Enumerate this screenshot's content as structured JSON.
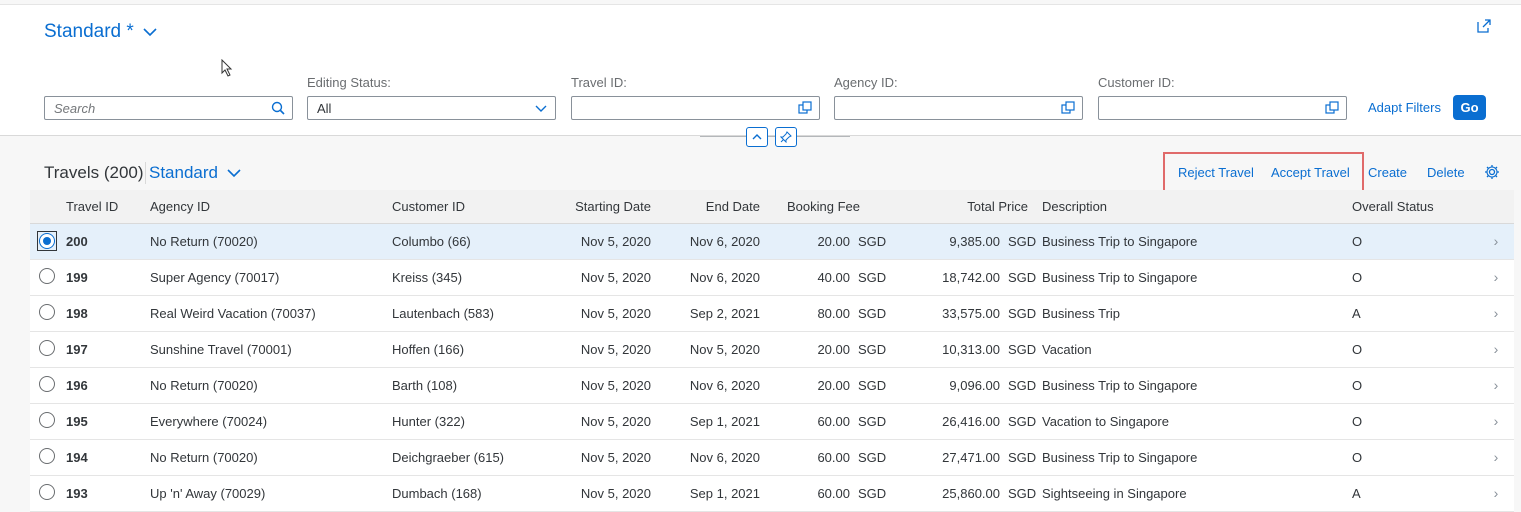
{
  "header": {
    "variant_label": "Standard *",
    "search": {
      "placeholder": "Search"
    },
    "filters": [
      {
        "label": "Editing Status:",
        "value": "All"
      },
      {
        "label": "Travel ID:",
        "value": ""
      },
      {
        "label": "Agency ID:",
        "value": ""
      },
      {
        "label": "Customer ID:",
        "value": ""
      }
    ],
    "adapt_filters_label": "Adapt Filters",
    "go_label": "Go"
  },
  "toolbar": {
    "title": "Travels (200)",
    "variant_label": "Standard",
    "reject_label": "Reject Travel",
    "accept_label": "Accept Travel",
    "create_label": "Create",
    "delete_label": "Delete"
  },
  "table": {
    "columns": [
      "Travel ID",
      "Agency ID",
      "Customer ID",
      "Starting Date",
      "End Date",
      "Booking Fee",
      "Total Price",
      "Description",
      "Overall Status"
    ],
    "rows": [
      {
        "id": "200",
        "agency": "No Return (70020)",
        "customer": "Columbo (66)",
        "start": "Nov 5, 2020",
        "end": "Nov 6, 2020",
        "fee": "20.00",
        "fee_cur": "SGD",
        "price": "9,385.00",
        "price_cur": "SGD",
        "desc": "Business Trip to Singapore",
        "status": "O"
      },
      {
        "id": "199",
        "agency": "Super Agency (70017)",
        "customer": "Kreiss (345)",
        "start": "Nov 5, 2020",
        "end": "Nov 6, 2020",
        "fee": "40.00",
        "fee_cur": "SGD",
        "price": "18,742.00",
        "price_cur": "SGD",
        "desc": "Business Trip to Singapore",
        "status": "O"
      },
      {
        "id": "198",
        "agency": "Real Weird Vacation (70037)",
        "customer": "Lautenbach (583)",
        "start": "Nov 5, 2020",
        "end": "Sep 2, 2021",
        "fee": "80.00",
        "fee_cur": "SGD",
        "price": "33,575.00",
        "price_cur": "SGD",
        "desc": "Business Trip",
        "status": "A"
      },
      {
        "id": "197",
        "agency": "Sunshine Travel (70001)",
        "customer": "Hoffen (166)",
        "start": "Nov 5, 2020",
        "end": "Nov 5, 2020",
        "fee": "20.00",
        "fee_cur": "SGD",
        "price": "10,313.00",
        "price_cur": "SGD",
        "desc": "Vacation",
        "status": "O"
      },
      {
        "id": "196",
        "agency": "No Return (70020)",
        "customer": "Barth (108)",
        "start": "Nov 5, 2020",
        "end": "Nov 6, 2020",
        "fee": "20.00",
        "fee_cur": "SGD",
        "price": "9,096.00",
        "price_cur": "SGD",
        "desc": "Business Trip to Singapore",
        "status": "O"
      },
      {
        "id": "195",
        "agency": "Everywhere (70024)",
        "customer": "Hunter (322)",
        "start": "Nov 5, 2020",
        "end": "Sep 1, 2021",
        "fee": "60.00",
        "fee_cur": "SGD",
        "price": "26,416.00",
        "price_cur": "SGD",
        "desc": "Vacation to Singapore",
        "status": "O"
      },
      {
        "id": "194",
        "agency": "No Return (70020)",
        "customer": "Deichgraeber (615)",
        "start": "Nov 5, 2020",
        "end": "Nov 6, 2020",
        "fee": "60.00",
        "fee_cur": "SGD",
        "price": "27,471.00",
        "price_cur": "SGD",
        "desc": "Business Trip to Singapore",
        "status": "O"
      },
      {
        "id": "193",
        "agency": "Up 'n' Away (70029)",
        "customer": "Dumbach (168)",
        "start": "Nov 5, 2020",
        "end": "Sep 1, 2021",
        "fee": "60.00",
        "fee_cur": "SGD",
        "price": "25,860.00",
        "price_cur": "SGD",
        "desc": "Sightseeing in Singapore",
        "status": "A"
      }
    ]
  },
  "colors": {
    "accent": "#0a6ed1",
    "highlight_box": "#e06a6a",
    "selected_row": "#e5f0fa"
  }
}
